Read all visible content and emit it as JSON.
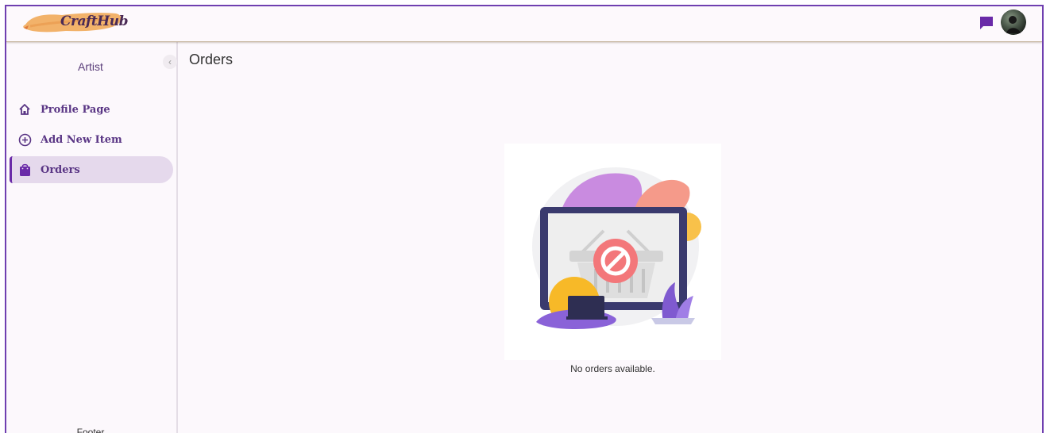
{
  "header": {
    "logo_text": "CraftHub",
    "chat_icon": "chat-icon",
    "avatar_icon": "avatar"
  },
  "sidebar": {
    "title": "Artist",
    "collapse_icon": "chevron-left-icon",
    "items": [
      {
        "label": "Profile Page",
        "icon": "home-icon",
        "active": false
      },
      {
        "label": "Add New Item",
        "icon": "add-circle-icon",
        "active": false
      },
      {
        "label": "Orders",
        "icon": "shopping-bag-icon",
        "active": true
      }
    ],
    "footer": "Footer"
  },
  "main": {
    "title": "Orders",
    "empty_message": "No orders available."
  },
  "colors": {
    "accent": "#6a2aa8",
    "frame": "#6f3fb0",
    "active_bg": "#e5d9ec"
  }
}
